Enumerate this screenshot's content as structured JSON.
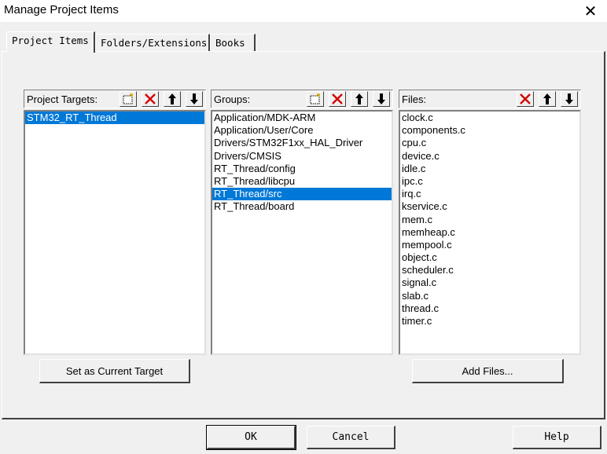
{
  "window": {
    "title": "Manage Project Items"
  },
  "tabs": [
    {
      "label": "Project Items"
    },
    {
      "label": "Folders/Extensions"
    },
    {
      "label": "Books"
    }
  ],
  "targets": {
    "header": "Project Targets:",
    "items": [
      "STM32_RT_Thread"
    ],
    "selected": "STM32_RT_Thread"
  },
  "groups": {
    "header": "Groups:",
    "items": [
      "Application/MDK-ARM",
      "Application/User/Core",
      "Drivers/STM32F1xx_HAL_Driver",
      "Drivers/CMSIS",
      "RT_Thread/config",
      "RT_Thread/libcpu",
      "RT_Thread/src",
      "RT_Thread/board"
    ],
    "selected": "RT_Thread/src"
  },
  "files": {
    "header": "Files:",
    "items": [
      "clock.c",
      "components.c",
      "cpu.c",
      "device.c",
      "idle.c",
      "ipc.c",
      "irq.c",
      "kservice.c",
      "mem.c",
      "memheap.c",
      "mempool.c",
      "object.c",
      "scheduler.c",
      "signal.c",
      "slab.c",
      "thread.c",
      "timer.c"
    ]
  },
  "buttons": {
    "set_current_target": "Set as Current Target",
    "add_files": "Add Files...",
    "ok": "OK",
    "cancel": "Cancel",
    "help": "Help"
  },
  "icons": {
    "new": "new-item-icon",
    "delete": "delete-icon",
    "up": "move-up-icon",
    "down": "move-down-icon",
    "close": "close-icon"
  },
  "colors": {
    "selection": "#0078d7",
    "delete_red": "#d40000"
  }
}
